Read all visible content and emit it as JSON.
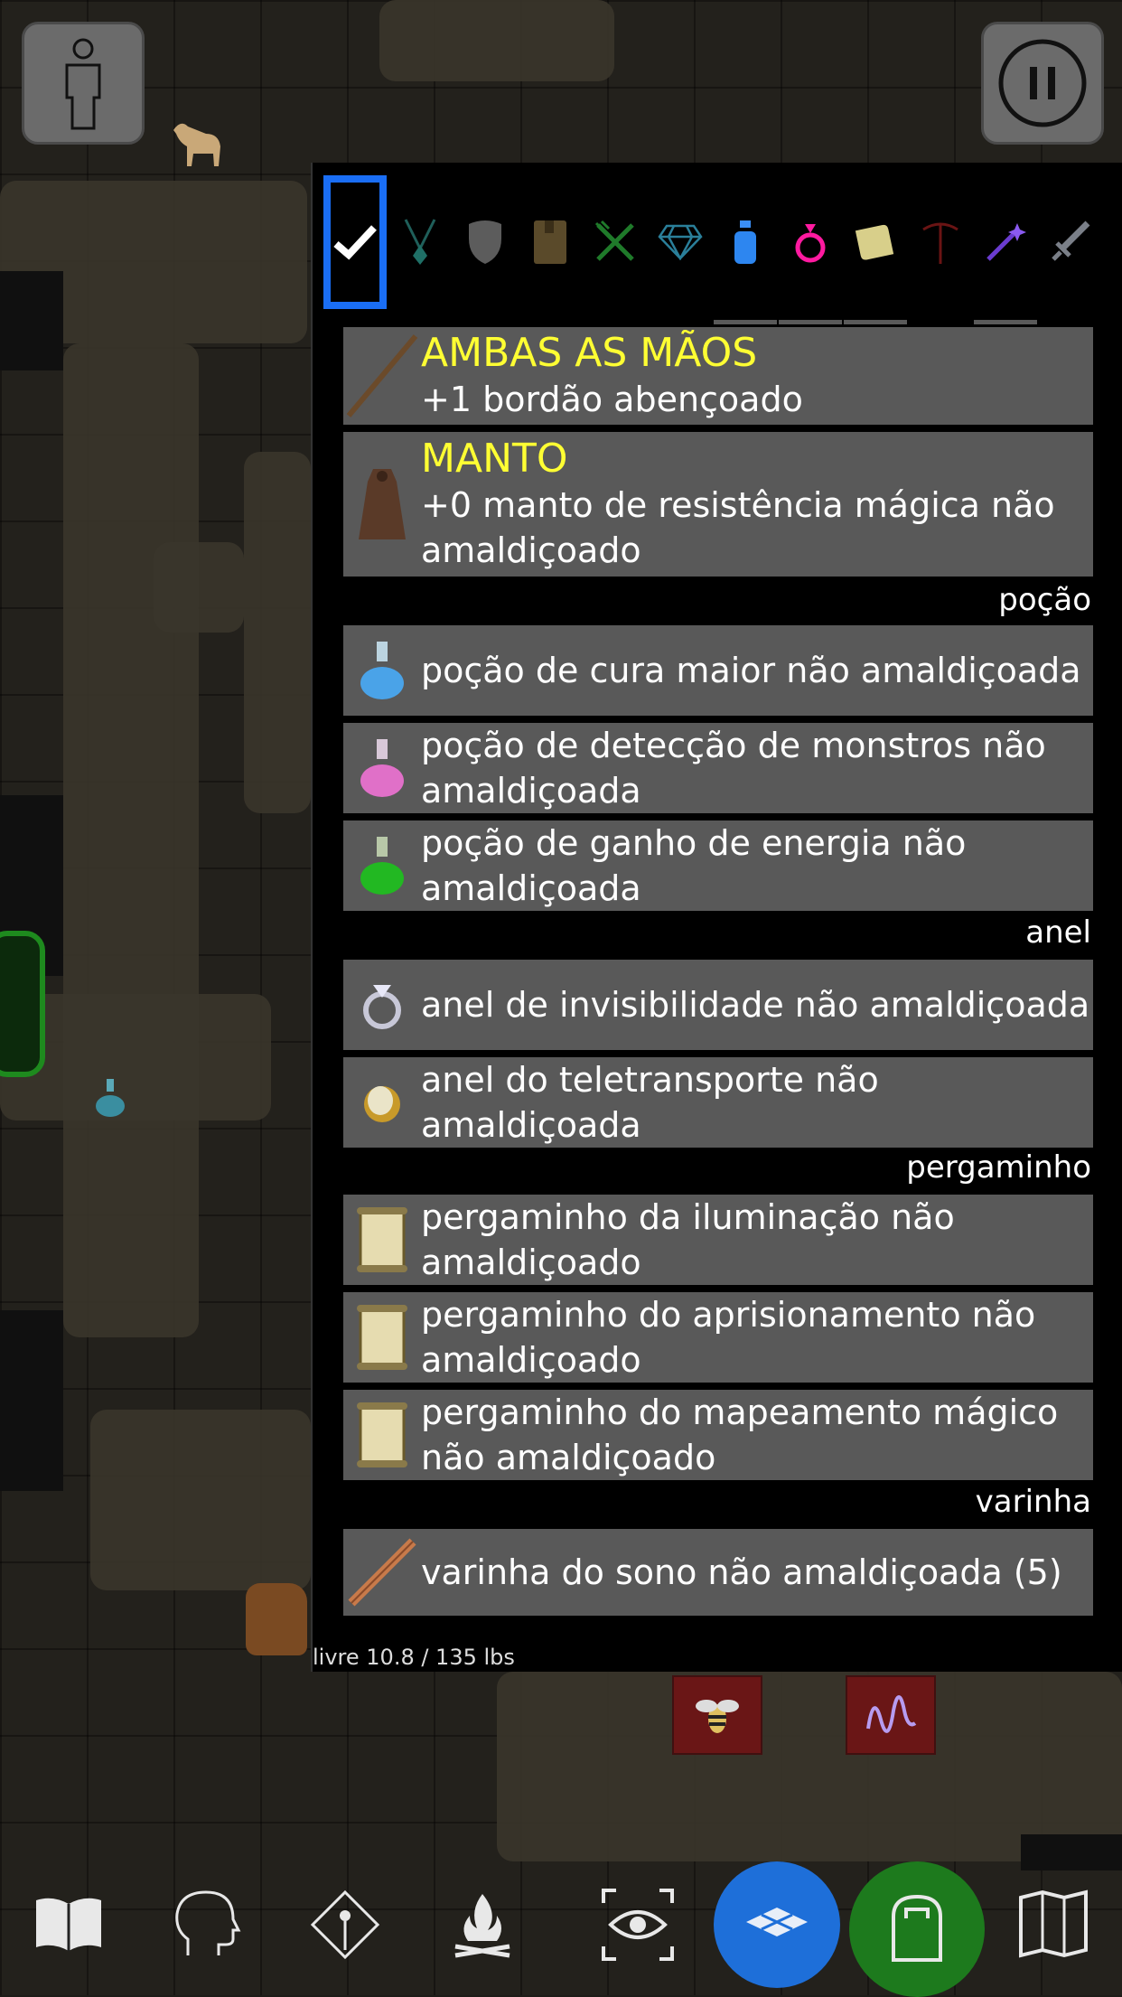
{
  "top_left_button": {
    "icon": "person-icon"
  },
  "top_right_button": {
    "icon": "pause-icon"
  },
  "filters": [
    {
      "icon": "check-icon",
      "active": true
    },
    {
      "icon": "amulet-icon"
    },
    {
      "icon": "shield-icon"
    },
    {
      "icon": "book-icon"
    },
    {
      "icon": "fork-knife-icon"
    },
    {
      "icon": "gem-icon"
    },
    {
      "icon": "potion-icon"
    },
    {
      "icon": "ring-icon"
    },
    {
      "icon": "scroll-icon"
    },
    {
      "icon": "pickaxe-icon"
    },
    {
      "icon": "wand-icon"
    },
    {
      "icon": "sword-icon"
    }
  ],
  "equipped": [
    {
      "slot": "AMBAS AS MÃOS",
      "name": "+1 bordão abençoado",
      "icon": "staff-icon"
    },
    {
      "slot": "MANTO",
      "name": "+0 manto de resistência mágica não amaldiçoado",
      "icon": "cloak-icon"
    }
  ],
  "categories": {
    "potion": {
      "header": "poção",
      "items": [
        {
          "name": "poção de cura maior não amaldiçoada",
          "icon": "blue-potion-icon",
          "color": "#4aa3e8"
        },
        {
          "name": "poção de detecção de monstros não amaldiçoada",
          "icon": "pink-potion-icon",
          "color": "#e070c8"
        },
        {
          "name": "poção de ganho de energia não amaldiçoada",
          "icon": "green-potion-icon",
          "color": "#22b822"
        }
      ]
    },
    "ring": {
      "header": "anel",
      "items": [
        {
          "name": "anel de invisibilidade não amaldiçoada",
          "icon": "silver-ring-icon"
        },
        {
          "name": "anel do teletransporte não amaldiçoada",
          "icon": "gold-ring-icon"
        }
      ]
    },
    "scroll": {
      "header": "pergaminho",
      "items": [
        {
          "name": "pergaminho da iluminação não amaldiçoado",
          "icon": "scroll-item-icon"
        },
        {
          "name": "pergaminho do aprisionamento não amaldiçoado",
          "icon": "scroll-item-icon"
        },
        {
          "name": "pergaminho do mapeamento mágico não amaldiçoado",
          "icon": "scroll-item-icon"
        }
      ]
    },
    "wand": {
      "header": "varinha",
      "items": [
        {
          "name": "varinha do sono não amaldiçoada (5)",
          "icon": "wand-item-icon"
        }
      ]
    }
  },
  "weight": "livre 10.8 / 135 lbs",
  "toolbar": [
    {
      "icon": "spellbook-icon"
    },
    {
      "icon": "head-icon"
    },
    {
      "icon": "compass-icon"
    },
    {
      "icon": "campfire-icon"
    },
    {
      "icon": "look-icon"
    },
    {
      "icon": "tiles-icon",
      "active": true,
      "color": "#1e6fd9"
    },
    {
      "icon": "inventory-icon",
      "active": true,
      "color": "#1d7a1d"
    },
    {
      "icon": "map-icon"
    }
  ],
  "accent_color": "#1a6ef5",
  "slot_color": "#ffff33"
}
